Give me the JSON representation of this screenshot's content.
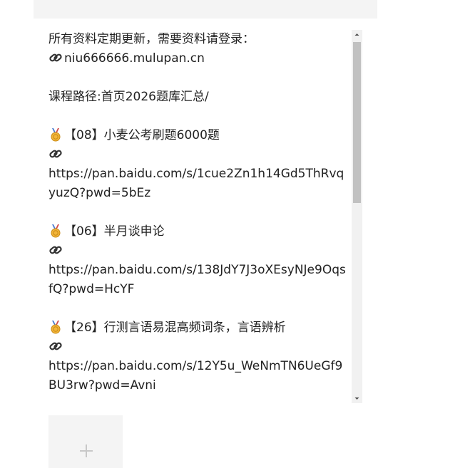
{
  "post": {
    "intro_line1": "所有资料定期更新，需要资料请登录：",
    "intro_site": "niu666666.mulupan.cn",
    "path_line": "课程路径:首页2026题库汇总/",
    "items": [
      {
        "title": "【08】小麦公考刷题6000题",
        "url": "https://pan.baidu.com/s/1cue2Zn1h14Gd5ThRvqyuzQ?pwd=5bEz"
      },
      {
        "title": "【06】半月谈申论",
        "url": "https://pan.baidu.com/s/138JdY7J3oXEsyNJe9OqsfQ?pwd=HcYF"
      },
      {
        "title": "【26】行测言语易混高频词条，言语辨析",
        "url": "https://pan.baidu.com/s/12Y5u_WeNmTN6UeGf9BU3rw?pwd=Avni"
      }
    ]
  },
  "icons": {
    "link": "link-icon",
    "medal": "medal-icon",
    "upload": "plus-icon"
  },
  "colors": {
    "text": "#222222",
    "panel_bg": "#f4f4f4",
    "scroll_thumb": "#c1c1c1",
    "medal_gold": "#f2b53a",
    "medal_ribbon": "#4a7bd0"
  }
}
